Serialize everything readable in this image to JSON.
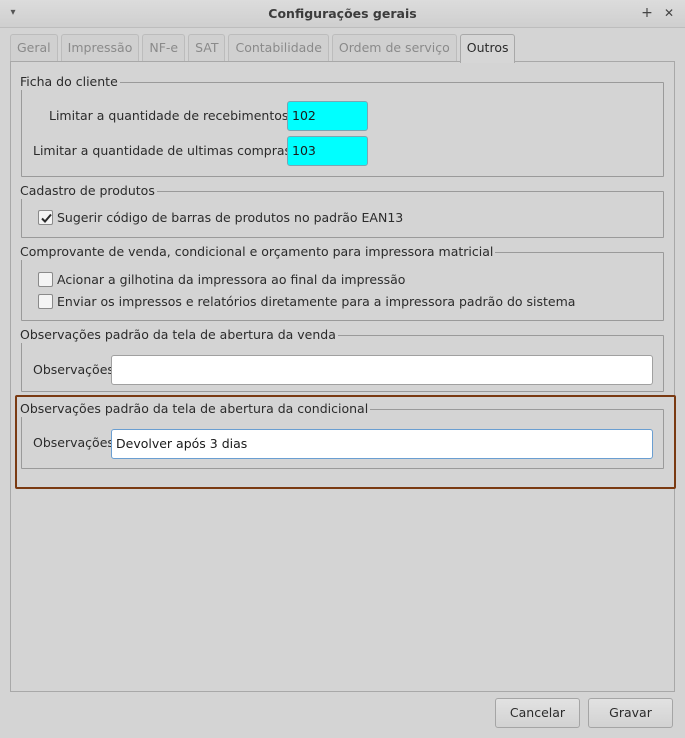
{
  "window": {
    "title": "Configurações gerais",
    "pin_glyph": "+",
    "close_glyph": "✕",
    "menu_glyph": "▾"
  },
  "tabs": [
    {
      "label": "Geral",
      "active": false
    },
    {
      "label": "Impressão",
      "active": false
    },
    {
      "label": "NF-e",
      "active": false
    },
    {
      "label": "SAT",
      "active": false
    },
    {
      "label": "Contabilidade",
      "active": false
    },
    {
      "label": "Ordem de serviço",
      "active": false
    },
    {
      "label": "Outros",
      "active": true
    }
  ],
  "ficha_cliente": {
    "title": "Ficha do cliente",
    "recebimentos_label": "Limitar a quantidade de recebimentos em",
    "recebimentos_value": "102",
    "compras_label": "Limitar a quantidade de ultimas compras em",
    "compras_value": "103"
  },
  "cadastro_produtos": {
    "title": "Cadastro de produtos",
    "ean13_label": "Sugerir código de barras de produtos no padrão EAN13",
    "ean13_checked": true
  },
  "impressora_matricial": {
    "title": "Comprovante de venda, condicional e orçamento para impressora matricial",
    "guilhotina_label": "Acionar a gilhotina da impressora ao final da impressão",
    "guilhotina_checked": false,
    "direto_label": "Enviar os impressos e relatórios diretamente para a impressora padrão do sistema",
    "direto_checked": false
  },
  "obs_venda": {
    "title": "Observações padrão da tela de abertura da venda",
    "label": "Observações",
    "value": ""
  },
  "obs_condicional": {
    "title": "Observações padrão da tela de abertura da condicional",
    "label": "Observações",
    "value": "Devolver após 3 dias"
  },
  "buttons": {
    "cancel": "Cancelar",
    "save": "Gravar"
  },
  "colors": {
    "highlight": "#7a3a12",
    "cyan_field": "#00ffff"
  }
}
